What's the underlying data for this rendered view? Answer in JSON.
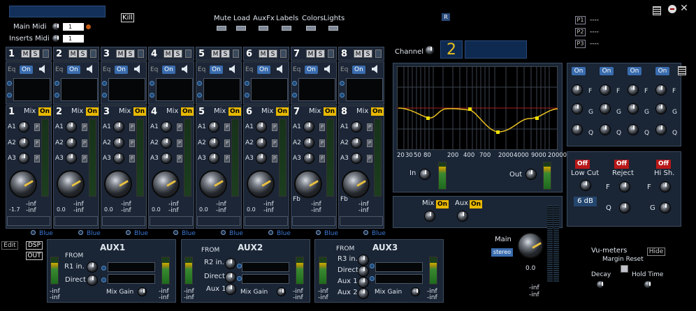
{
  "top": {
    "kill_label": "Kill",
    "main_midi_label": "Main Midi",
    "main_midi_value": "1",
    "inserts_midi_label": "Inserts Midi",
    "inserts_midi_value": "1",
    "toolbar": [
      "Mute",
      "Load",
      "AuxFx",
      "Labels",
      "Colors",
      "Lights"
    ],
    "r_label": "R",
    "presets": [
      {
        "label": "P1",
        "value": "----"
      },
      {
        "label": "P2",
        "value": "----"
      },
      {
        "label": "P3",
        "value": "----"
      }
    ]
  },
  "channel": {
    "label": "Channel",
    "value": "2"
  },
  "strips": [
    {
      "num": "1",
      "mix": "Mix",
      "on": "On",
      "vol": "-1.7",
      "meter": "-inf",
      "meter2": "-inf",
      "blue": "Blue",
      "fb": ""
    },
    {
      "num": "2",
      "mix": "Mix",
      "on": "On",
      "vol": "0.0",
      "meter": "-inf",
      "meter2": "-inf",
      "blue": "Blue",
      "fb": ""
    },
    {
      "num": "3",
      "mix": "Mix",
      "on": "On",
      "vol": "0.0",
      "meter": "-inf",
      "meter2": "-inf",
      "blue": "Blue",
      "fb": ""
    },
    {
      "num": "4",
      "mix": "Mix",
      "on": "On",
      "vol": "0.0",
      "meter": "-inf",
      "meter2": "-inf",
      "blue": "Blue",
      "fb": ""
    },
    {
      "num": "5",
      "mix": "Mix",
      "on": "On",
      "vol": "0.0",
      "meter": "-inf",
      "meter2": "-inf",
      "blue": "Blue",
      "fb": ""
    },
    {
      "num": "6",
      "mix": "Mix",
      "on": "On",
      "vol": "0.0",
      "meter": "-inf",
      "meter2": "-inf",
      "blue": "Blue",
      "fb": ""
    },
    {
      "num": "7",
      "mix": "Mix",
      "on": "On",
      "vol": "",
      "meter": "-inf",
      "meter2": "-inf",
      "blue": "Blue",
      "fb": "Fb"
    },
    {
      "num": "8",
      "mix": "Mix",
      "on": "On",
      "vol": "",
      "meter": "-inf",
      "meter2": "-inf",
      "blue": "Blue",
      "fb": "Fb"
    }
  ],
  "strip_labels": {
    "m": "M",
    "s": "S",
    "eq": "Eq",
    "eq_on": "On",
    "a1": "A1",
    "a2": "A2",
    "a3": "A3",
    "p": "P"
  },
  "eq_graph": {
    "freq_labels": [
      "20",
      "30",
      "50",
      "80",
      "200",
      "400",
      "700",
      "2000",
      "4000",
      "9000",
      "20000"
    ],
    "in_label": "In",
    "out_label": "Out"
  },
  "eq_bands": {
    "on_label": "On",
    "f": "F",
    "g": "G",
    "q": "Q"
  },
  "filters": {
    "low_cut": "Low Cut",
    "reject": "Reject",
    "hi_sh": "Hi Sh.",
    "off": "Off",
    "f": "F",
    "q": "Q",
    "g": "G",
    "db": "6 dB"
  },
  "mixaux": {
    "mix": "Mix",
    "aux": "Aux",
    "on": "On"
  },
  "bottom": {
    "edit": "Edit",
    "dsp": "DSP",
    "out": "OUT"
  },
  "aux1": {
    "title": "AUX1",
    "from": "FROM",
    "r1": "R1 in.",
    "direct": "Direct",
    "mix_gain": "Mix Gain",
    "inf1": "-inf",
    "inf2": "-inf",
    "inf3": "-inf",
    "inf4": "-inf"
  },
  "aux2": {
    "title": "AUX2",
    "from": "FROM",
    "r2": "R2 in.",
    "direct": "Direct",
    "aux1": "Aux 1",
    "mix_gain": "Mix Gain",
    "inf1": "-inf",
    "inf2": "-inf",
    "inf3": "-inf",
    "inf4": "-inf"
  },
  "aux3": {
    "title": "AUX3",
    "from": "FROM",
    "r3": "R3 in.",
    "direct": "Direct",
    "aux1": "Aux 1",
    "aux2": "Aux 2",
    "mix_gain": "Mix Gain",
    "inf1": "-inf",
    "inf2": "-inf",
    "inf3": "-inf",
    "inf4": "-inf"
  },
  "main": {
    "label": "Main",
    "stereo": "stereo",
    "value": "0.0",
    "inf1": "-inf",
    "inf2": "-inf"
  },
  "vu": {
    "label": "Vu-meters",
    "hide": "Hide",
    "margin_reset": "Margin Reset",
    "decay": "Decay",
    "hold_time": "Hold Time"
  },
  "colors": {
    "accent": "#e8b800",
    "eq_curve": "#e8c020",
    "off_red": "#b81818",
    "eq_on_blue": "#3a6cae"
  }
}
